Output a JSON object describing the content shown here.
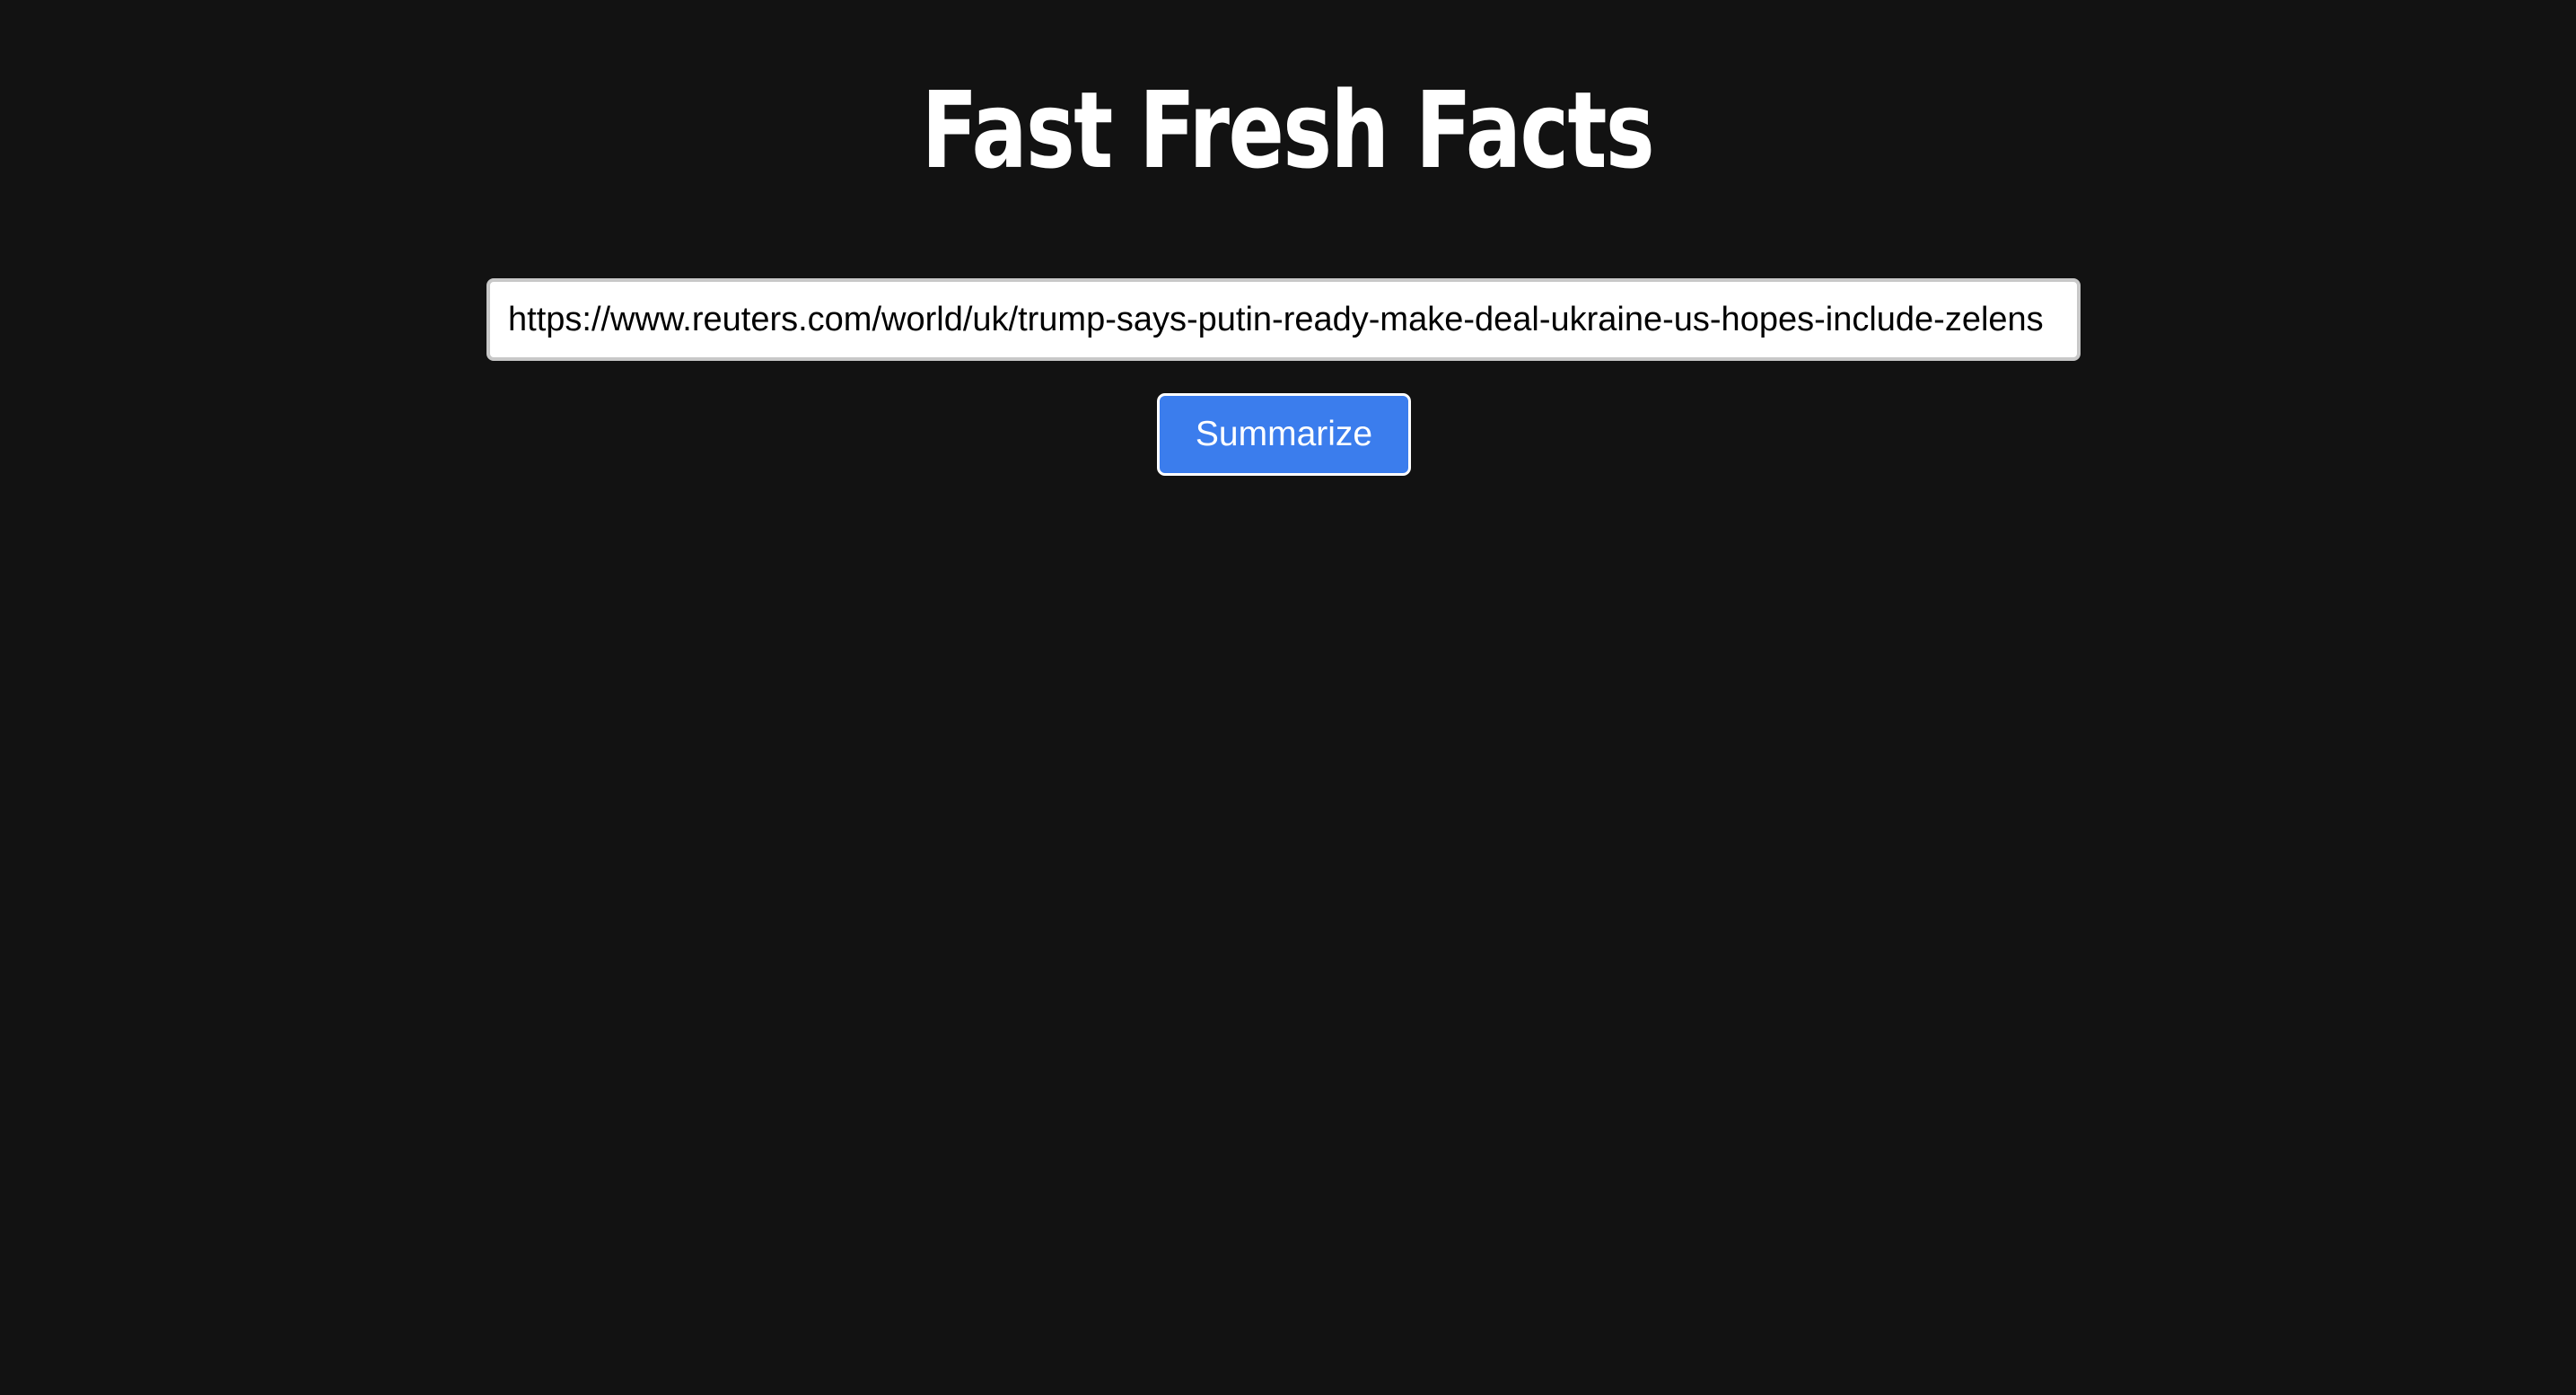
{
  "header": {
    "title": "Fast Fresh Facts"
  },
  "form": {
    "url_value": "https://www.reuters.com/world/uk/trump-says-putin-ready-make-deal-ukraine-us-hopes-include-zelens",
    "summarize_label": "Summarize"
  },
  "colors": {
    "background": "#121212",
    "button_accent": "#3b7ded",
    "title_text": "#ffffff"
  }
}
